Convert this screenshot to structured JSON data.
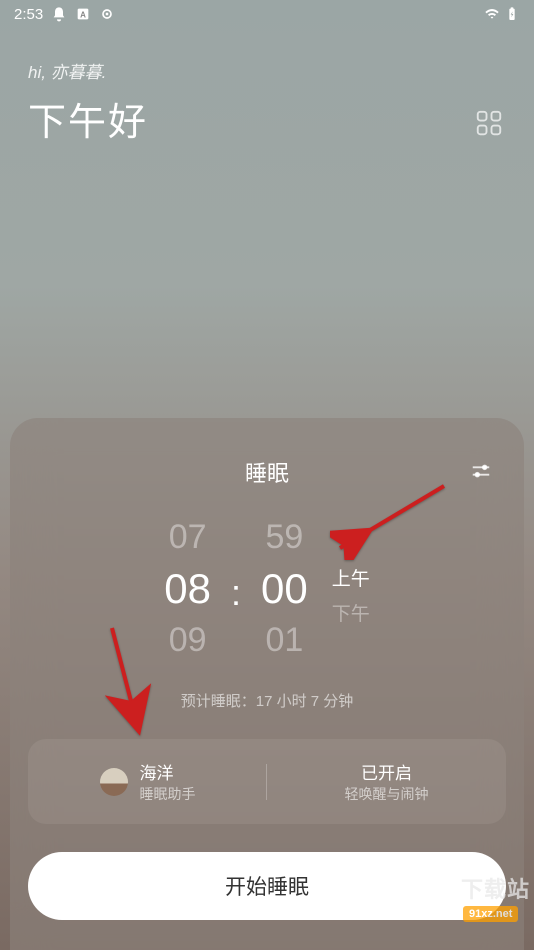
{
  "status": {
    "time": "2:53"
  },
  "header": {
    "greeting_small": "hi, 亦暮暮.",
    "greeting_large": "下午好"
  },
  "sleep": {
    "title": "睡眠",
    "hours_prev": "07",
    "hours_sel": "08",
    "hours_next": "09",
    "mins_prev": "59",
    "mins_sel": "00",
    "mins_next": "01",
    "am": "上午",
    "pm": "下午",
    "estimate": "预计睡眠：17 小时 7 分钟",
    "feature1_title": "海洋",
    "feature1_sub": "睡眠助手",
    "feature2_title": "已开启",
    "feature2_sub": "轻唤醒与闹钟",
    "start_label": "开始睡眠"
  },
  "watermark": {
    "text1": "下载站",
    "text2": "91xz.net"
  }
}
